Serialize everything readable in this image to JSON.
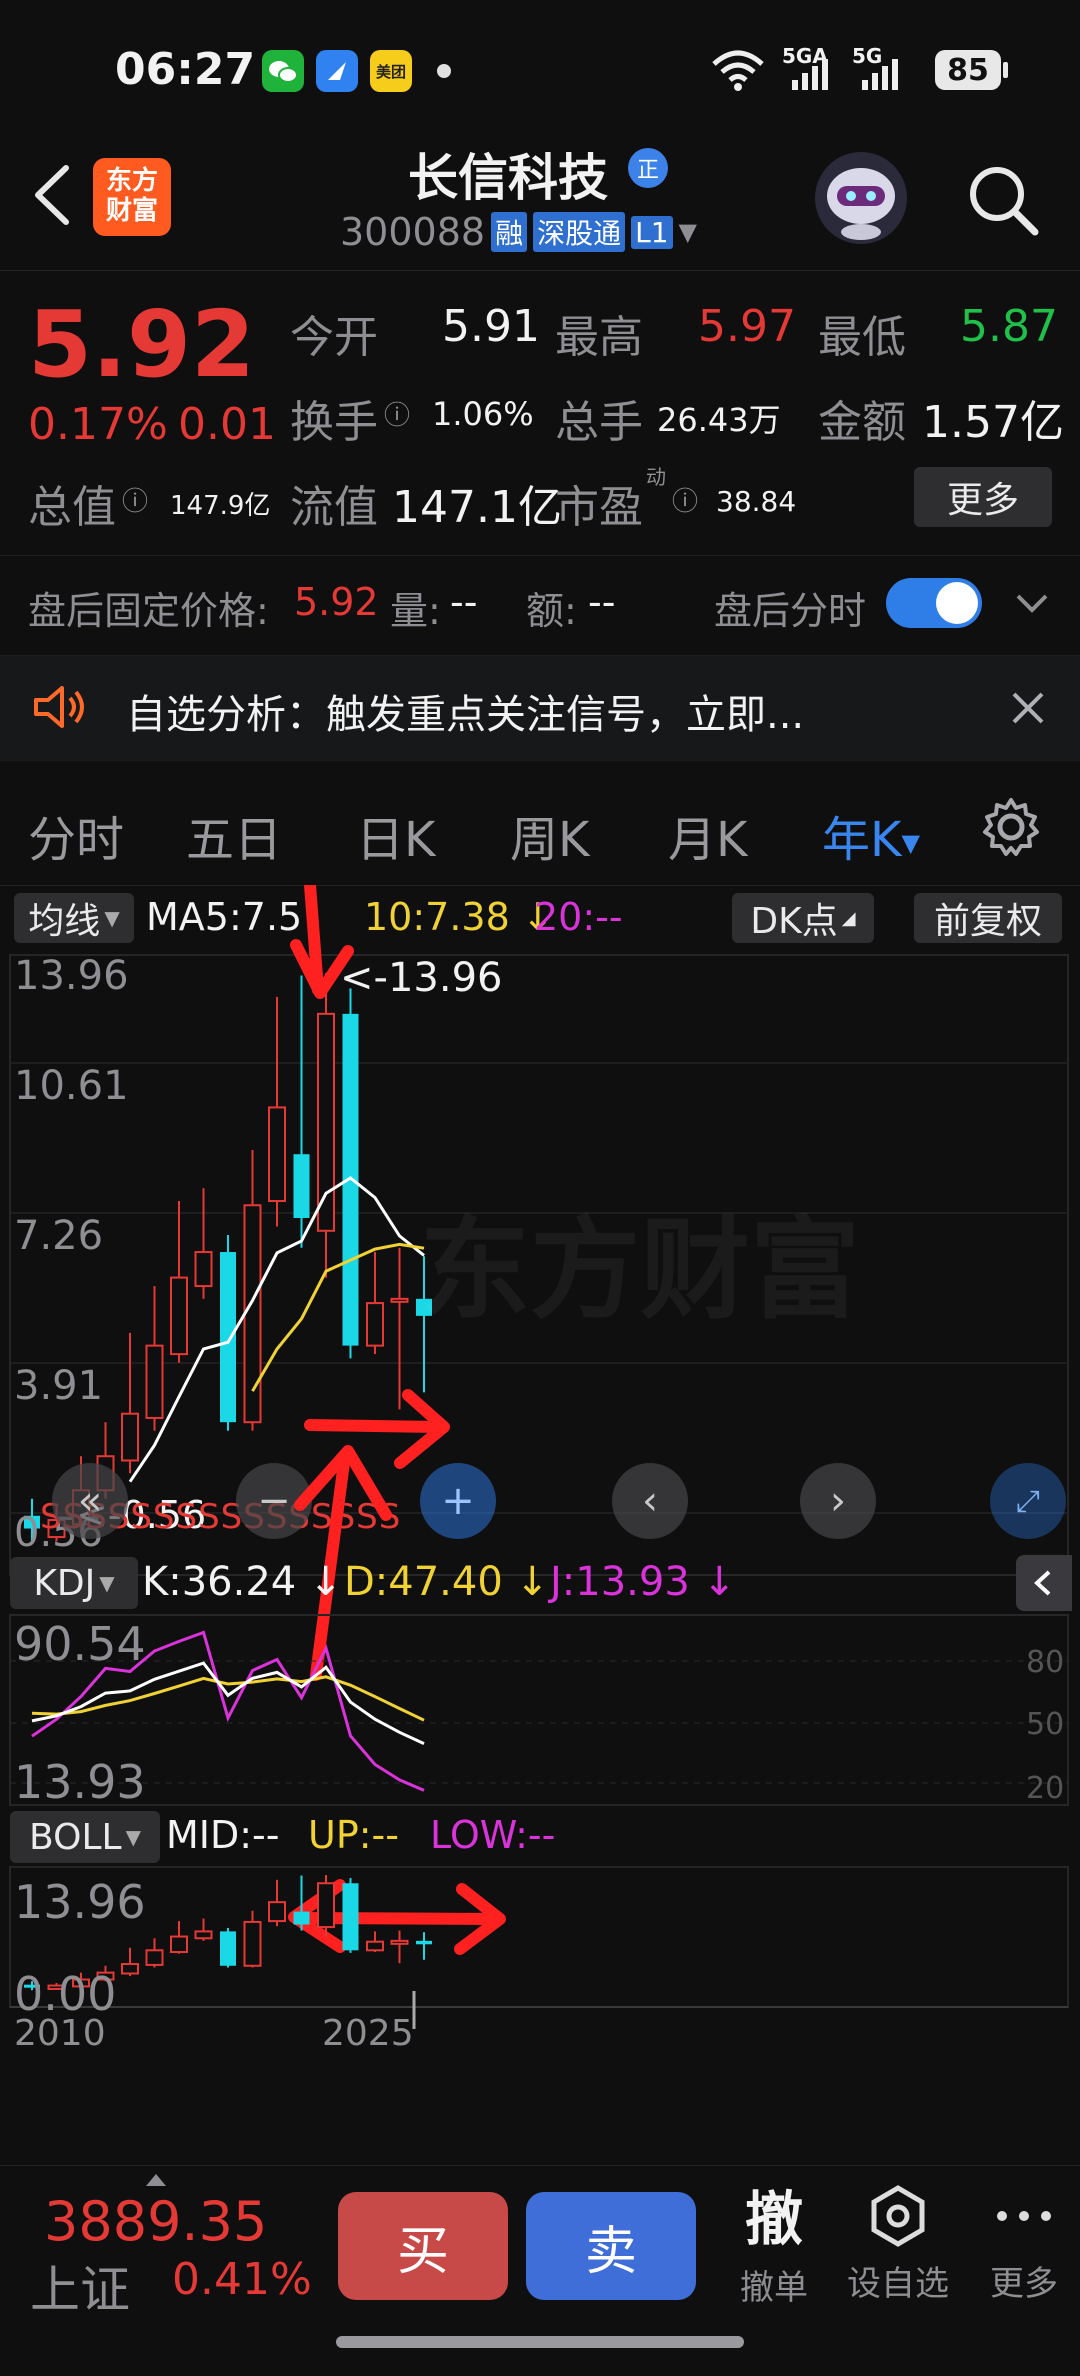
{
  "status_bar": {
    "time": "06:27",
    "app_badge_meituan": "美团",
    "network1": "5G",
    "network1_sup": "A",
    "network2": "5G",
    "battery": "85"
  },
  "header": {
    "brand_logo_top": "东方",
    "brand_logo_bottom": "财富",
    "stock_name": "长信科技",
    "badge_zheng": "正",
    "stock_code": "300088",
    "tag_rong": "融",
    "tag_sgt": "深股通",
    "tag_level": "L1"
  },
  "quote": {
    "price": "5.92",
    "change_pct": "0.17%",
    "change_abs": "0.01",
    "open_label": "今开",
    "open_value": "5.91",
    "high_label": "最高",
    "high_value": "5.97",
    "low_label": "最低",
    "low_value": "5.87",
    "turnover_label": "换手",
    "turnover_value": "1.06%",
    "volume_label": "总手",
    "volume_value": "26.43万",
    "amount_label": "金额",
    "amount_value": "1.57亿",
    "mktcap_label": "总值",
    "mktcap_value": "147.9亿",
    "float_label": "流值",
    "float_value": "147.1亿",
    "pe_label": "市盈",
    "pe_sup": "动",
    "pe_value": "38.84",
    "more_label": "更多"
  },
  "after_hours": {
    "label": "盘后固定价格:",
    "price": "5.92",
    "vol_label": "量:",
    "vol_value": "--",
    "amt_label": "额:",
    "amt_value": "--",
    "toggle_label": "盘后分时",
    "toggle_on": true
  },
  "banner": {
    "text": "自选分析：触发重点关注信号，立即..."
  },
  "tabs": {
    "items": [
      "分时",
      "五日",
      "日K",
      "周K",
      "月K",
      "年K"
    ],
    "active": "年K"
  },
  "main_indicator": {
    "selector": "均线",
    "ma5": "MA5:7.5",
    "ma10": "10:7.38",
    "ma20": "20:--",
    "dk_label": "DK点",
    "adjust_label": "前复权",
    "y_max": "13.96",
    "y_2": "10.61",
    "y_3": "7.26",
    "y_4": "3.91",
    "y_min": "0.56",
    "high_marker": "<-13.96",
    "low_marker": "<-0.56",
    "signal_row": "SSSSSSSSSSSSSSSS",
    "watermark": "东方财富"
  },
  "kdj": {
    "selector": "KDJ",
    "k": "K:36.24",
    "d": "D:47.40",
    "j": "J:13.93",
    "y_top": "90.54",
    "y_bottom": "13.93",
    "ref_80": "80",
    "ref_50": "50",
    "ref_20": "20"
  },
  "boll": {
    "selector": "BOLL",
    "mid": "MID:--",
    "up": "UP:--",
    "low": "LOW:--",
    "y_top": "13.96",
    "y_bottom": "0.00",
    "x_start": "2010",
    "x_end": "2025"
  },
  "bottom_bar": {
    "index_value": "3889.35",
    "index_name": "上证",
    "index_change": "0.41%",
    "buy_label": "买",
    "sell_label": "卖",
    "cancel_glyph": "撤",
    "cancel_label": "撤单",
    "watchlist_label": "设自选",
    "more_label": "更多"
  },
  "colors": {
    "up": "#e53935",
    "down": "#1ad8e6",
    "accent_blue": "#2f7ee8",
    "ma5": "#ffffff",
    "ma10": "#f1d235",
    "ma20": "#d933d9"
  },
  "chart_data": [
    {
      "type": "candlestick",
      "title": "",
      "x_range": [
        "2010",
        "2025"
      ],
      "ylim": [
        0.56,
        13.96
      ],
      "y_ticks": [
        13.96,
        10.61,
        7.26,
        3.91,
        0.56
      ],
      "series": [
        {
          "name": "MA5",
          "value": 7.5
        },
        {
          "name": "MA10",
          "value": 7.38
        }
      ],
      "candles": [
        {
          "o": 1.2,
          "c": 0.9,
          "h": 1.6,
          "l": 0.56
        },
        {
          "o": 0.7,
          "c": 1.1,
          "h": 1.4,
          "l": 0.6
        },
        {
          "o": 1.0,
          "c": 1.8,
          "h": 2.6,
          "l": 0.8
        },
        {
          "o": 1.8,
          "c": 2.6,
          "h": 3.4,
          "l": 1.6
        },
        {
          "o": 2.5,
          "c": 3.6,
          "h": 5.5,
          "l": 2.2
        },
        {
          "o": 3.5,
          "c": 5.2,
          "h": 6.6,
          "l": 3.2
        },
        {
          "o": 5.0,
          "c": 6.8,
          "h": 8.6,
          "l": 4.8
        },
        {
          "o": 6.6,
          "c": 7.4,
          "h": 8.9,
          "l": 6.3
        },
        {
          "o": 7.4,
          "c": 3.4,
          "h": 7.8,
          "l": 3.2
        },
        {
          "o": 3.4,
          "c": 8.5,
          "h": 9.8,
          "l": 3.2
        },
        {
          "o": 8.6,
          "c": 10.8,
          "h": 13.4,
          "l": 8.0
        },
        {
          "o": 9.7,
          "c": 8.2,
          "h": 13.9,
          "l": 7.5
        },
        {
          "o": 7.9,
          "c": 13.0,
          "h": 13.96,
          "l": 6.8
        },
        {
          "o": 13.0,
          "c": 5.2,
          "h": 13.6,
          "l": 4.9
        },
        {
          "o": 5.2,
          "c": 6.2,
          "h": 7.4,
          "l": 5.0
        },
        {
          "o": 6.3,
          "c": 6.3,
          "h": 7.5,
          "l": 3.7
        },
        {
          "o": 6.3,
          "c": 5.9,
          "h": 7.3,
          "l": 4.1
        }
      ]
    },
    {
      "type": "line",
      "title": "KDJ",
      "ylim": [
        13.93,
        90.54
      ],
      "series": [
        {
          "name": "K",
          "value": 36.24
        },
        {
          "name": "D",
          "value": 47.4
        },
        {
          "name": "J",
          "value": 13.93
        }
      ],
      "reference_lines": [
        80,
        50,
        20
      ]
    },
    {
      "type": "candlestick",
      "title": "BOLL",
      "ylim": [
        0.0,
        13.96
      ],
      "x_labels": [
        "2010",
        "2025"
      ]
    }
  ]
}
